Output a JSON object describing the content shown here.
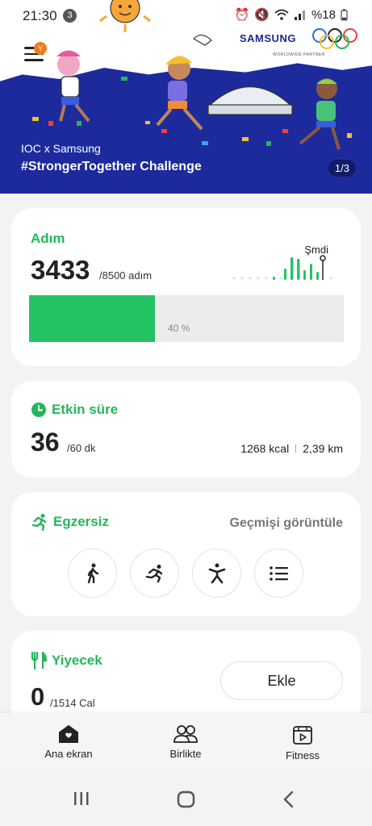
{
  "status_bar": {
    "time": "21:30",
    "notification_count": "3",
    "battery": "%18"
  },
  "banner": {
    "menu_badge": "Y",
    "brand": "SAMSUNG",
    "partner": "WORLDWIDE PARTNER",
    "subtitle": "IOC x Samsung",
    "title": "#StrongerTogether Challenge",
    "pager": "1/3"
  },
  "steps": {
    "title": "Adım",
    "value": "3433",
    "goal": "/8500 adım",
    "now_label": "Şmdi",
    "progress_percent": 40,
    "progress_label": "40 %",
    "accent": "#23c364"
  },
  "active_time": {
    "title": "Etkin süre",
    "value": "36",
    "goal": "/60 dk",
    "calories": "1268 kcal",
    "distance": "2,39 km"
  },
  "exercise": {
    "title": "Egzersiz",
    "history_link": "Geçmişi görüntüle",
    "buttons": [
      "walking-icon",
      "running-icon",
      "workout-icon",
      "list-icon"
    ]
  },
  "food": {
    "title": "Yiyecek",
    "value": "0",
    "goal": "/1514 Cal",
    "add_label": "Ekle"
  },
  "bottom_nav": {
    "home": "Ana ekran",
    "together": "Birlikte",
    "fitness": "Fitness"
  }
}
